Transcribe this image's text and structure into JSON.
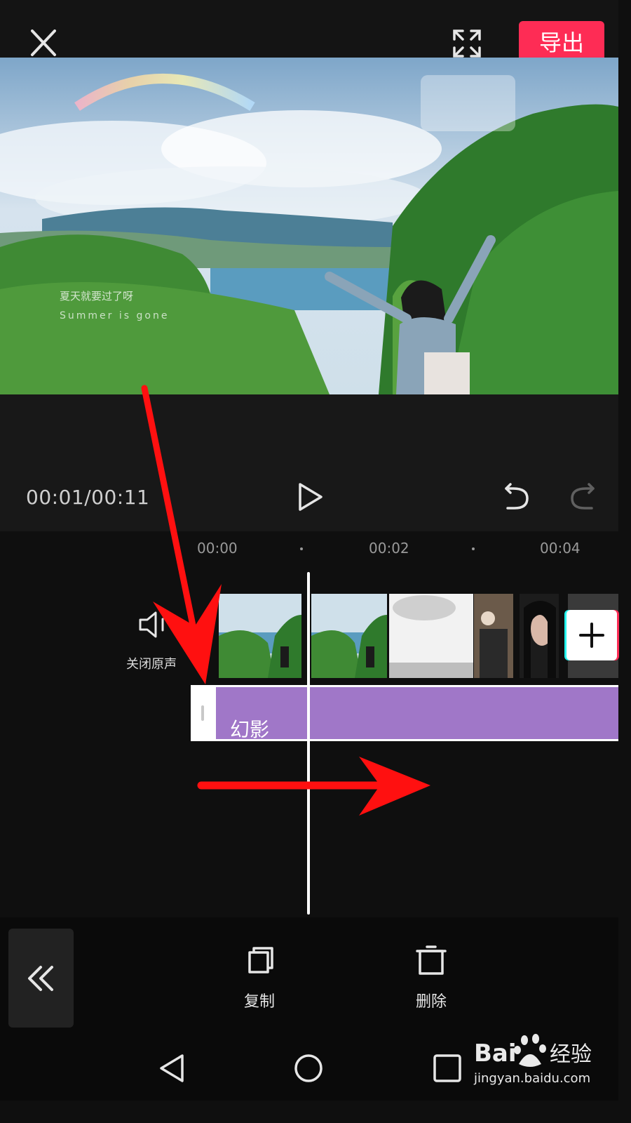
{
  "top_bar": {
    "export_label": "导出"
  },
  "preview": {
    "overlay_line1": "夏天就要过了呀",
    "overlay_line2": "Summer is gone"
  },
  "playback": {
    "time_readout": "00:01/00:11"
  },
  "timeline": {
    "ruler": [
      "00:00",
      "00:02",
      "00:04"
    ],
    "mute_label": "关闭原声",
    "effect_label": "幻影"
  },
  "toolbar": {
    "copy_label": "复制",
    "delete_label": "删除"
  },
  "watermark": {
    "brand": "Bai",
    "brand_cn": "经验",
    "url": "jingyan.baidu.com"
  },
  "colors": {
    "accent": "#fe2c55",
    "effect_track": "#a077c8",
    "annotation_arrow": "#ff1010"
  }
}
